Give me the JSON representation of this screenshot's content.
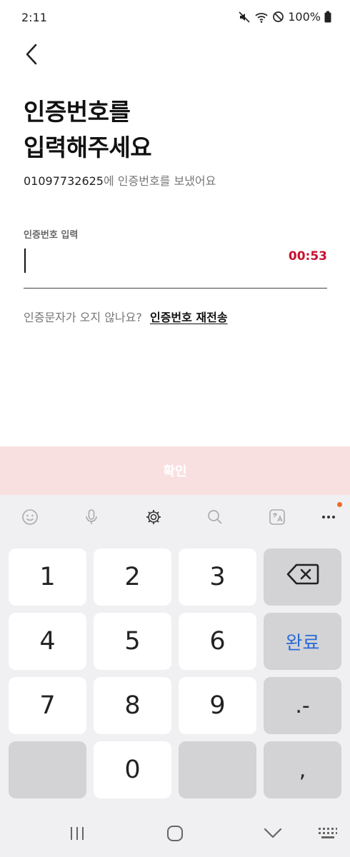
{
  "status_bar": {
    "time": "2:11",
    "battery": "100%"
  },
  "header": {
    "back_icon": "chevron-left-icon"
  },
  "main": {
    "title_line1": "인증번호를",
    "title_line2": "입력해주세요",
    "phone_number": "01097732625",
    "subtitle_suffix": "에 인증번호를 보냈어요",
    "field_label": "인증번호 입력",
    "code_value": "",
    "timer": "00:53",
    "resend_prompt": "인증문자가 오지 않나요?",
    "resend_link": "인증번호 재전송"
  },
  "confirm_button": {
    "label": "확인",
    "color": "#f9e0e0"
  },
  "keyboard": {
    "toolbar_icons": [
      "emoji-icon",
      "mic-icon",
      "settings-icon",
      "search-icon",
      "translate-icon",
      "more-icon"
    ],
    "keys": {
      "k1": "1",
      "k2": "2",
      "k3": "3",
      "k4": "4",
      "k5": "5",
      "k6": "6",
      "k7": "7",
      "k8": "8",
      "k9": "9",
      "k0": "0",
      "done": "완료",
      "dot_dash": ".-",
      "comma": ","
    }
  },
  "nav_bar": {
    "icons": [
      "recent-apps-icon",
      "home-icon",
      "back-icon",
      "keyboard-icon"
    ]
  },
  "colors": {
    "timer": "#c8102e",
    "done_key": "#2a6bd6",
    "keyboard_bg": "#f0f0f2"
  }
}
